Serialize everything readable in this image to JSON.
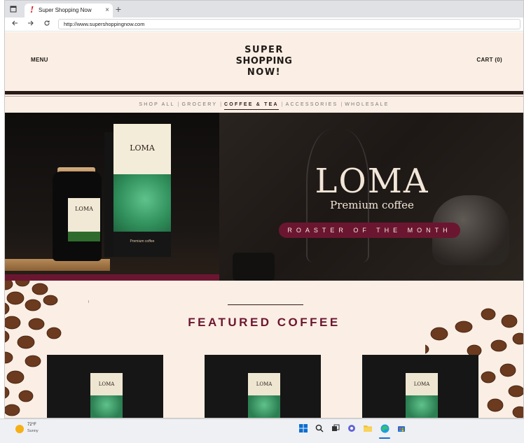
{
  "browser": {
    "tab_title": "Super Shopping Now",
    "tab_favicon": "!",
    "tab_close": "×",
    "new_tab": "+",
    "url": "http://www.supershoppingnow.com"
  },
  "site": {
    "menu_label": "MENU",
    "cart_label": "CART (0)",
    "logo_lines": [
      "SUPER",
      "SHOPPING",
      "NOW!"
    ],
    "categories": [
      {
        "label": "SHOP ALL",
        "active": false
      },
      {
        "label": "GROCERY",
        "active": false
      },
      {
        "label": "COFFEE & TEA",
        "active": true
      },
      {
        "label": "ACCESSORIES",
        "active": false
      },
      {
        "label": "WHOLESALE",
        "active": false
      }
    ],
    "category_separator": "|"
  },
  "hero": {
    "brand": "LOMA",
    "subtitle": "Premium coffee",
    "badge": "ROASTER OF THE MONTH",
    "product_brand": "LOMA",
    "product_subtitle": "Premium coffee"
  },
  "featured": {
    "title": "FEATURED COFFEE",
    "products": [
      {
        "brand": "LOMA"
      },
      {
        "brand": "LOMA"
      },
      {
        "brand": "LOMA"
      }
    ]
  },
  "taskbar": {
    "temperature": "72°F",
    "condition": "Sunny",
    "icons": [
      "windows-start-icon",
      "search-icon",
      "task-view-icon",
      "chat-icon",
      "file-explorer-icon",
      "edge-browser-icon",
      "store-icon"
    ]
  },
  "colors": {
    "page_background": "#fbeee4",
    "accent_burgundy": "#6b1631",
    "dark_brown": "#2b1b18"
  }
}
